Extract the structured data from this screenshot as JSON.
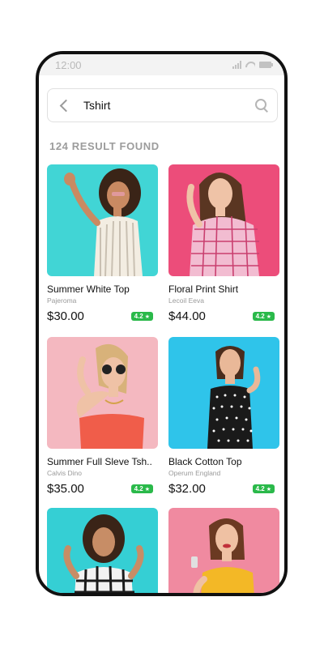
{
  "status_bar": {
    "time": "12:00"
  },
  "search": {
    "value": "Tshirt"
  },
  "results": {
    "count_label": "124 RESULT  FOUND"
  },
  "products": [
    {
      "title": "Summer White Top",
      "brand": "Pajeroma",
      "price": "$30.00",
      "rating": "4.2",
      "image_bg": "#41d5d5"
    },
    {
      "title": "Floral Print Shirt",
      "brand": "Lecoil Eeva",
      "price": "$44.00",
      "rating": "4.2",
      "image_bg": "#ec4d7a"
    },
    {
      "title": "Summer Full Sleve Tsh..",
      "brand": "Calvis Dino",
      "price": "$35.00",
      "rating": "4.2",
      "image_bg": "#f4b8c0"
    },
    {
      "title": "Black Cotton Top",
      "brand": "Operum England",
      "price": "$32.00",
      "rating": "4.2",
      "image_bg": "#2fc4ea"
    },
    {
      "title": "",
      "brand": "",
      "price": "",
      "rating": "",
      "image_bg": "#35cfd4"
    },
    {
      "title": "",
      "brand": "",
      "price": "",
      "rating": "",
      "image_bg": "#f08aa0"
    }
  ],
  "colors": {
    "rating_green": "#2ab94a",
    "muted_text": "#9c9c9c"
  },
  "icons": {
    "back": "chevron-left-icon",
    "search": "search-icon",
    "star": "star-icon"
  }
}
